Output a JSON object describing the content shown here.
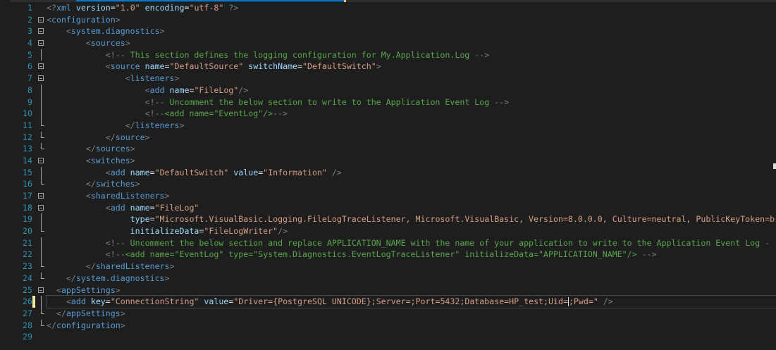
{
  "editor": {
    "caret_line": 26,
    "lines": [
      {
        "num": "1",
        "fold": "none",
        "tokens": [
          {
            "c": "t-pi",
            "t": "<?"
          },
          {
            "c": "t-tag",
            "t": "xml"
          },
          {
            "c": "t-attr",
            "t": " version"
          },
          {
            "c": "t-eq",
            "t": "="
          },
          {
            "c": "t-str",
            "t": "\"1.0\""
          },
          {
            "c": "t-attr",
            "t": " encoding"
          },
          {
            "c": "t-eq",
            "t": "="
          },
          {
            "c": "t-str",
            "t": "\"utf-8\""
          },
          {
            "c": "t-pi",
            "t": " ?>"
          }
        ]
      },
      {
        "num": "2",
        "fold": "open",
        "tokens": [
          {
            "c": "t-bracket",
            "t": "<"
          },
          {
            "c": "t-tag",
            "t": "configuration"
          },
          {
            "c": "t-bracket",
            "t": ">"
          }
        ]
      },
      {
        "num": "3",
        "fold": "open",
        "tokens": [
          {
            "c": "t-text",
            "t": "    "
          },
          {
            "c": "t-bracket",
            "t": "<"
          },
          {
            "c": "t-tag",
            "t": "system.diagnostics"
          },
          {
            "c": "t-bracket",
            "t": ">"
          }
        ]
      },
      {
        "num": "4",
        "fold": "open",
        "tokens": [
          {
            "c": "t-text",
            "t": "        "
          },
          {
            "c": "t-bracket",
            "t": "<"
          },
          {
            "c": "t-tag",
            "t": "sources"
          },
          {
            "c": "t-bracket",
            "t": ">"
          }
        ]
      },
      {
        "num": "5",
        "fold": "guide",
        "tokens": [
          {
            "c": "t-text",
            "t": "            "
          },
          {
            "c": "t-bracket",
            "t": "<!--"
          },
          {
            "c": "t-comment",
            "t": " This section defines the logging configuration for My.Application.Log "
          },
          {
            "c": "t-bracket",
            "t": "-->"
          }
        ]
      },
      {
        "num": "6",
        "fold": "open",
        "tokens": [
          {
            "c": "t-text",
            "t": "            "
          },
          {
            "c": "t-bracket",
            "t": "<"
          },
          {
            "c": "t-tag",
            "t": "source"
          },
          {
            "c": "t-attr",
            "t": " name"
          },
          {
            "c": "t-eq",
            "t": "="
          },
          {
            "c": "t-str",
            "t": "\"DefaultSource\""
          },
          {
            "c": "t-attr",
            "t": " switchName"
          },
          {
            "c": "t-eq",
            "t": "="
          },
          {
            "c": "t-str",
            "t": "\"DefaultSwitch\""
          },
          {
            "c": "t-bracket",
            "t": ">"
          }
        ]
      },
      {
        "num": "7",
        "fold": "open",
        "tokens": [
          {
            "c": "t-text",
            "t": "                "
          },
          {
            "c": "t-bracket",
            "t": "<"
          },
          {
            "c": "t-tag",
            "t": "listeners"
          },
          {
            "c": "t-bracket",
            "t": ">"
          }
        ]
      },
      {
        "num": "8",
        "fold": "guide",
        "tokens": [
          {
            "c": "t-text",
            "t": "                    "
          },
          {
            "c": "t-bracket",
            "t": "<"
          },
          {
            "c": "t-tag",
            "t": "add"
          },
          {
            "c": "t-attr",
            "t": " name"
          },
          {
            "c": "t-eq",
            "t": "="
          },
          {
            "c": "t-str",
            "t": "\"FileLog\""
          },
          {
            "c": "t-bracket",
            "t": "/>"
          }
        ]
      },
      {
        "num": "9",
        "fold": "guide",
        "tokens": [
          {
            "c": "t-text",
            "t": "                    "
          },
          {
            "c": "t-bracket",
            "t": "<!--"
          },
          {
            "c": "t-comment",
            "t": " Uncomment the below section to write to the Application Event Log "
          },
          {
            "c": "t-bracket",
            "t": "-->"
          }
        ]
      },
      {
        "num": "10",
        "fold": "guide",
        "tokens": [
          {
            "c": "t-text",
            "t": "                    "
          },
          {
            "c": "t-bracket",
            "t": "<!--"
          },
          {
            "c": "t-comment",
            "t": "<add name=\"EventLog\"/>"
          },
          {
            "c": "t-bracket",
            "t": "-->"
          }
        ]
      },
      {
        "num": "11",
        "fold": "end",
        "tokens": [
          {
            "c": "t-text",
            "t": "                "
          },
          {
            "c": "t-bracket",
            "t": "</"
          },
          {
            "c": "t-tag",
            "t": "listeners"
          },
          {
            "c": "t-bracket",
            "t": ">"
          }
        ]
      },
      {
        "num": "12",
        "fold": "end",
        "tokens": [
          {
            "c": "t-text",
            "t": "            "
          },
          {
            "c": "t-bracket",
            "t": "</"
          },
          {
            "c": "t-tag",
            "t": "source"
          },
          {
            "c": "t-bracket",
            "t": ">"
          }
        ]
      },
      {
        "num": "13",
        "fold": "end",
        "tokens": [
          {
            "c": "t-text",
            "t": "        "
          },
          {
            "c": "t-bracket",
            "t": "</"
          },
          {
            "c": "t-tag",
            "t": "sources"
          },
          {
            "c": "t-bracket",
            "t": ">"
          }
        ]
      },
      {
        "num": "14",
        "fold": "open",
        "tokens": [
          {
            "c": "t-text",
            "t": "        "
          },
          {
            "c": "t-bracket",
            "t": "<"
          },
          {
            "c": "t-tag",
            "t": "switches"
          },
          {
            "c": "t-bracket",
            "t": ">"
          }
        ]
      },
      {
        "num": "15",
        "fold": "guide",
        "tokens": [
          {
            "c": "t-text",
            "t": "            "
          },
          {
            "c": "t-bracket",
            "t": "<"
          },
          {
            "c": "t-tag",
            "t": "add"
          },
          {
            "c": "t-attr",
            "t": " name"
          },
          {
            "c": "t-eq",
            "t": "="
          },
          {
            "c": "t-str",
            "t": "\"DefaultSwitch\""
          },
          {
            "c": "t-attr",
            "t": " value"
          },
          {
            "c": "t-eq",
            "t": "="
          },
          {
            "c": "t-str",
            "t": "\"Information\""
          },
          {
            "c": "t-bracket",
            "t": " />"
          }
        ]
      },
      {
        "num": "16",
        "fold": "end",
        "tokens": [
          {
            "c": "t-text",
            "t": "        "
          },
          {
            "c": "t-bracket",
            "t": "</"
          },
          {
            "c": "t-tag",
            "t": "switches"
          },
          {
            "c": "t-bracket",
            "t": ">"
          }
        ]
      },
      {
        "num": "17",
        "fold": "open",
        "tokens": [
          {
            "c": "t-text",
            "t": "        "
          },
          {
            "c": "t-bracket",
            "t": "<"
          },
          {
            "c": "t-tag",
            "t": "sharedListeners"
          },
          {
            "c": "t-bracket",
            "t": ">"
          }
        ]
      },
      {
        "num": "18",
        "fold": "open",
        "tokens": [
          {
            "c": "t-text",
            "t": "            "
          },
          {
            "c": "t-bracket",
            "t": "<"
          },
          {
            "c": "t-tag",
            "t": "add"
          },
          {
            "c": "t-attr",
            "t": " name"
          },
          {
            "c": "t-eq",
            "t": "="
          },
          {
            "c": "t-str",
            "t": "\"FileLog\""
          }
        ]
      },
      {
        "num": "19",
        "fold": "guide",
        "tokens": [
          {
            "c": "t-text",
            "t": "                 "
          },
          {
            "c": "t-attr",
            "t": "type"
          },
          {
            "c": "t-eq",
            "t": "="
          },
          {
            "c": "t-str",
            "t": "\"Microsoft.VisualBasic.Logging.FileLogTraceListener, Microsoft.VisualBasic, Version=8.0.0.0, Culture=neutral, PublicKeyToken=b"
          }
        ]
      },
      {
        "num": "20",
        "fold": "end",
        "tokens": [
          {
            "c": "t-text",
            "t": "                 "
          },
          {
            "c": "t-attr",
            "t": "initializeData"
          },
          {
            "c": "t-eq",
            "t": "="
          },
          {
            "c": "t-str",
            "t": "\"FileLogWriter\""
          },
          {
            "c": "t-bracket",
            "t": "/>"
          }
        ]
      },
      {
        "num": "21",
        "fold": "guide",
        "tokens": [
          {
            "c": "t-text",
            "t": "            "
          },
          {
            "c": "t-bracket",
            "t": "<!--"
          },
          {
            "c": "t-comment",
            "t": " Uncomment the below section and replace APPLICATION_NAME with the name of your application to write to the Application Event Log -"
          }
        ]
      },
      {
        "num": "22",
        "fold": "guide",
        "tokens": [
          {
            "c": "t-text",
            "t": "            "
          },
          {
            "c": "t-bracket",
            "t": "<!--"
          },
          {
            "c": "t-comment",
            "t": "<add name=\"EventLog\" type=\"System.Diagnostics.EventLogTraceListener\" initializeData=\"APPLICATION_NAME\"/> "
          },
          {
            "c": "t-bracket",
            "t": "-->"
          }
        ]
      },
      {
        "num": "23",
        "fold": "end",
        "tokens": [
          {
            "c": "t-text",
            "t": "        "
          },
          {
            "c": "t-bracket",
            "t": "</"
          },
          {
            "c": "t-tag",
            "t": "sharedListeners"
          },
          {
            "c": "t-bracket",
            "t": ">"
          }
        ]
      },
      {
        "num": "24",
        "fold": "end",
        "tokens": [
          {
            "c": "t-text",
            "t": "    "
          },
          {
            "c": "t-bracket",
            "t": "</"
          },
          {
            "c": "t-tag",
            "t": "system.diagnostics"
          },
          {
            "c": "t-bracket",
            "t": ">"
          }
        ]
      },
      {
        "num": "25",
        "fold": "open",
        "tokens": [
          {
            "c": "t-text",
            "t": "  "
          },
          {
            "c": "t-bracket",
            "t": "<"
          },
          {
            "c": "t-tag",
            "t": "appSettings"
          },
          {
            "c": "t-bracket",
            "t": ">"
          }
        ]
      },
      {
        "num": "26",
        "fold": "guide",
        "changed": true,
        "tokens": [
          {
            "c": "t-text",
            "t": "    "
          },
          {
            "c": "t-bracket",
            "t": "<"
          },
          {
            "c": "t-tag",
            "t": "add"
          },
          {
            "c": "t-attr",
            "t": " key"
          },
          {
            "c": "t-eq",
            "t": "="
          },
          {
            "c": "t-str",
            "t": "\"ConnectionString\""
          },
          {
            "c": "t-attr",
            "t": " value"
          },
          {
            "c": "t-eq",
            "t": "="
          },
          {
            "c": "t-str",
            "t": "\"Driver={PostgreSQL UNICODE};Server=;Port=5432;Database=HP_test;Uid="
          },
          {
            "c": "caret",
            "t": ""
          },
          {
            "c": "t-str",
            "t": ";Pwd=\""
          },
          {
            "c": "t-bracket",
            "t": " />"
          }
        ]
      },
      {
        "num": "27",
        "fold": "end",
        "tokens": [
          {
            "c": "t-text",
            "t": "  "
          },
          {
            "c": "t-bracket",
            "t": "</"
          },
          {
            "c": "t-tag",
            "t": "appSettings"
          },
          {
            "c": "t-bracket",
            "t": ">"
          }
        ]
      },
      {
        "num": "28",
        "fold": "end",
        "tokens": [
          {
            "c": "t-bracket",
            "t": "</"
          },
          {
            "c": "t-tag",
            "t": "configuration"
          },
          {
            "c": "t-bracket",
            "t": ">"
          }
        ]
      },
      {
        "num": "29",
        "fold": "none",
        "tokens": []
      }
    ]
  }
}
